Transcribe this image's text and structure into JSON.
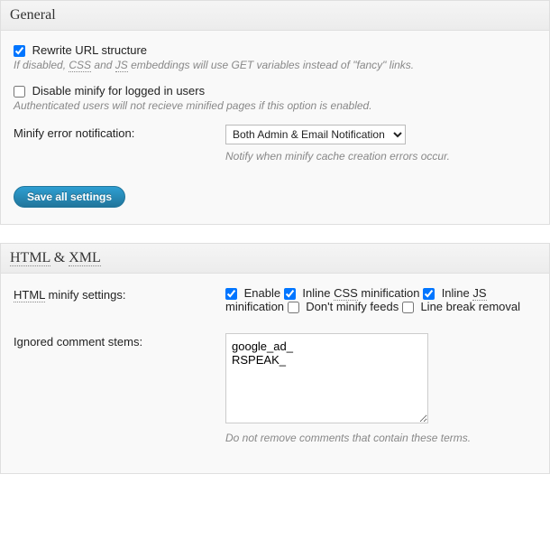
{
  "general": {
    "title": "General",
    "rewrite": {
      "label": "Rewrite URL structure",
      "checked": true,
      "desc_pre": "If disabled, ",
      "desc_css": "CSS",
      "desc_mid1": " and ",
      "desc_js": "JS",
      "desc_post": " embeddings will use GET variables instead of \"fancy\" links."
    },
    "disable_logged": {
      "label": "Disable minify for logged in users",
      "checked": false,
      "desc": "Authenticated users will not recieve minified pages if this option is enabled."
    },
    "error_notify": {
      "label": "Minify error notification:",
      "selected": "Both Admin & Email Notification",
      "note": "Notify when minify cache creation errors occur."
    },
    "save_label": "Save all settings"
  },
  "htmlxml": {
    "title_html": "HTML",
    "title_amp": " & ",
    "title_xml": "XML",
    "settings_label_html": "HTML",
    "settings_label_rest": " minify settings:",
    "opts": {
      "enable": {
        "label": "Enable",
        "checked": true
      },
      "inline_css_pre": "Inline ",
      "inline_css_abbr": "CSS",
      "inline_css_post": " minification",
      "inline_css_checked": true,
      "inline_js_pre": "Inline ",
      "inline_js_abbr": "JS",
      "inline_js_post": " minification",
      "inline_js_checked": true,
      "dont_minify_feeds": {
        "label": "Don't minify feeds",
        "checked": false
      },
      "line_break": {
        "label": "Line break removal",
        "checked": false
      }
    },
    "ignored": {
      "label": "Ignored comment stems:",
      "value": "google_ad_\nRSPEAK_",
      "note": "Do not remove comments that contain these terms."
    }
  }
}
